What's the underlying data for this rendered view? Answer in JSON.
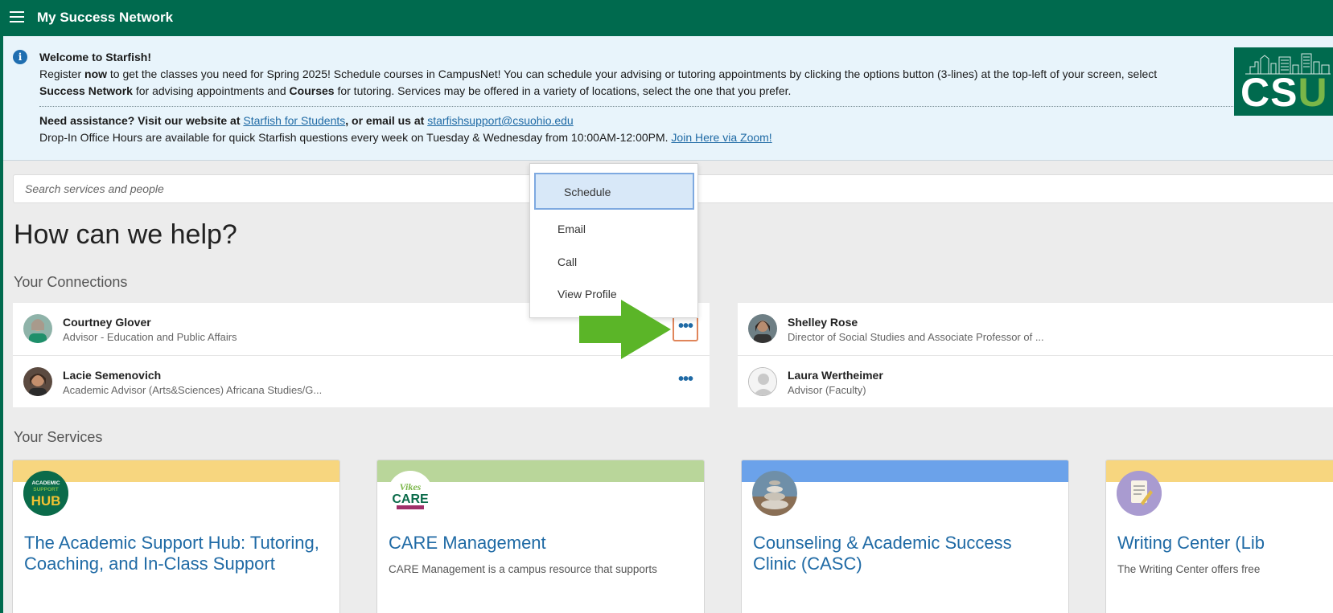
{
  "header": {
    "title": "My Success Network"
  },
  "banner": {
    "welcome": "Welcome to Starfish!",
    "line1_a": "Register ",
    "line1_b": "now",
    "line1_c": " to get the classes you need for Spring 2025! Schedule courses in CampusNet! You can schedule your advising or tutoring appointments by clicking the options button (3-lines) at the top-left of your screen, select ",
    "line1_d": "Success Network",
    "line1_e": " for advising appointments and ",
    "line1_f": "Courses",
    "line1_g": " for tutoring. Services may be offered in a variety of locations, select the one that you prefer.",
    "assist_a": "Need assistance? Visit our website at ",
    "assist_link": "Starfish for Students",
    "assist_b": ", or email us at ",
    "assist_email": "starfishsupport@csuohio.edu",
    "dropin": "Drop-In Office Hours are available for quick Starfish questions every week on Tuesday & Wednesday from 10:00AM-12:00PM. ",
    "zoom_link": "Join Here via Zoom!",
    "logo_text": "CS",
    "logo_u": "U"
  },
  "search": {
    "placeholder": "Search services and people"
  },
  "main": {
    "heading": "How can we help?",
    "connections_title": "Your Connections",
    "services_title": "Your Services"
  },
  "connections": [
    {
      "name": "Courtney Glover",
      "role": "Advisor - Education and Public Affairs"
    },
    {
      "name": "Lacie Semenovich",
      "role": "Academic Advisor (Arts&Sciences) Africana Studies/G..."
    },
    {
      "name": "Shelley Rose",
      "role": "Director of Social Studies and Associate Professor of ..."
    },
    {
      "name": "Laura Wertheimer",
      "role": "Advisor (Faculty)"
    }
  ],
  "menu": {
    "items": [
      "Schedule",
      "Email",
      "Call",
      "View Profile"
    ]
  },
  "more_glyph": "•••",
  "services": [
    {
      "title": "The Academic Support Hub: Tutoring, Coaching, and In-Class Support",
      "desc": "",
      "band": "#f7d67f",
      "logo_line1": "ACADEMIC",
      "logo_line2": "SUPPORT",
      "logo_line3": "HUB"
    },
    {
      "title": "CARE Management",
      "desc": "CARE Management is a campus resource that supports",
      "band": "#b9d69a",
      "logo_line1": "Vikes",
      "logo_line2": "CARE"
    },
    {
      "title": "Counseling & Academic Success Clinic (CASC)",
      "desc": "",
      "band": "#6ba2ea"
    },
    {
      "title": "Writing Center (Lib",
      "desc": "The Writing Center offers free",
      "band": "#f7d67f"
    }
  ]
}
